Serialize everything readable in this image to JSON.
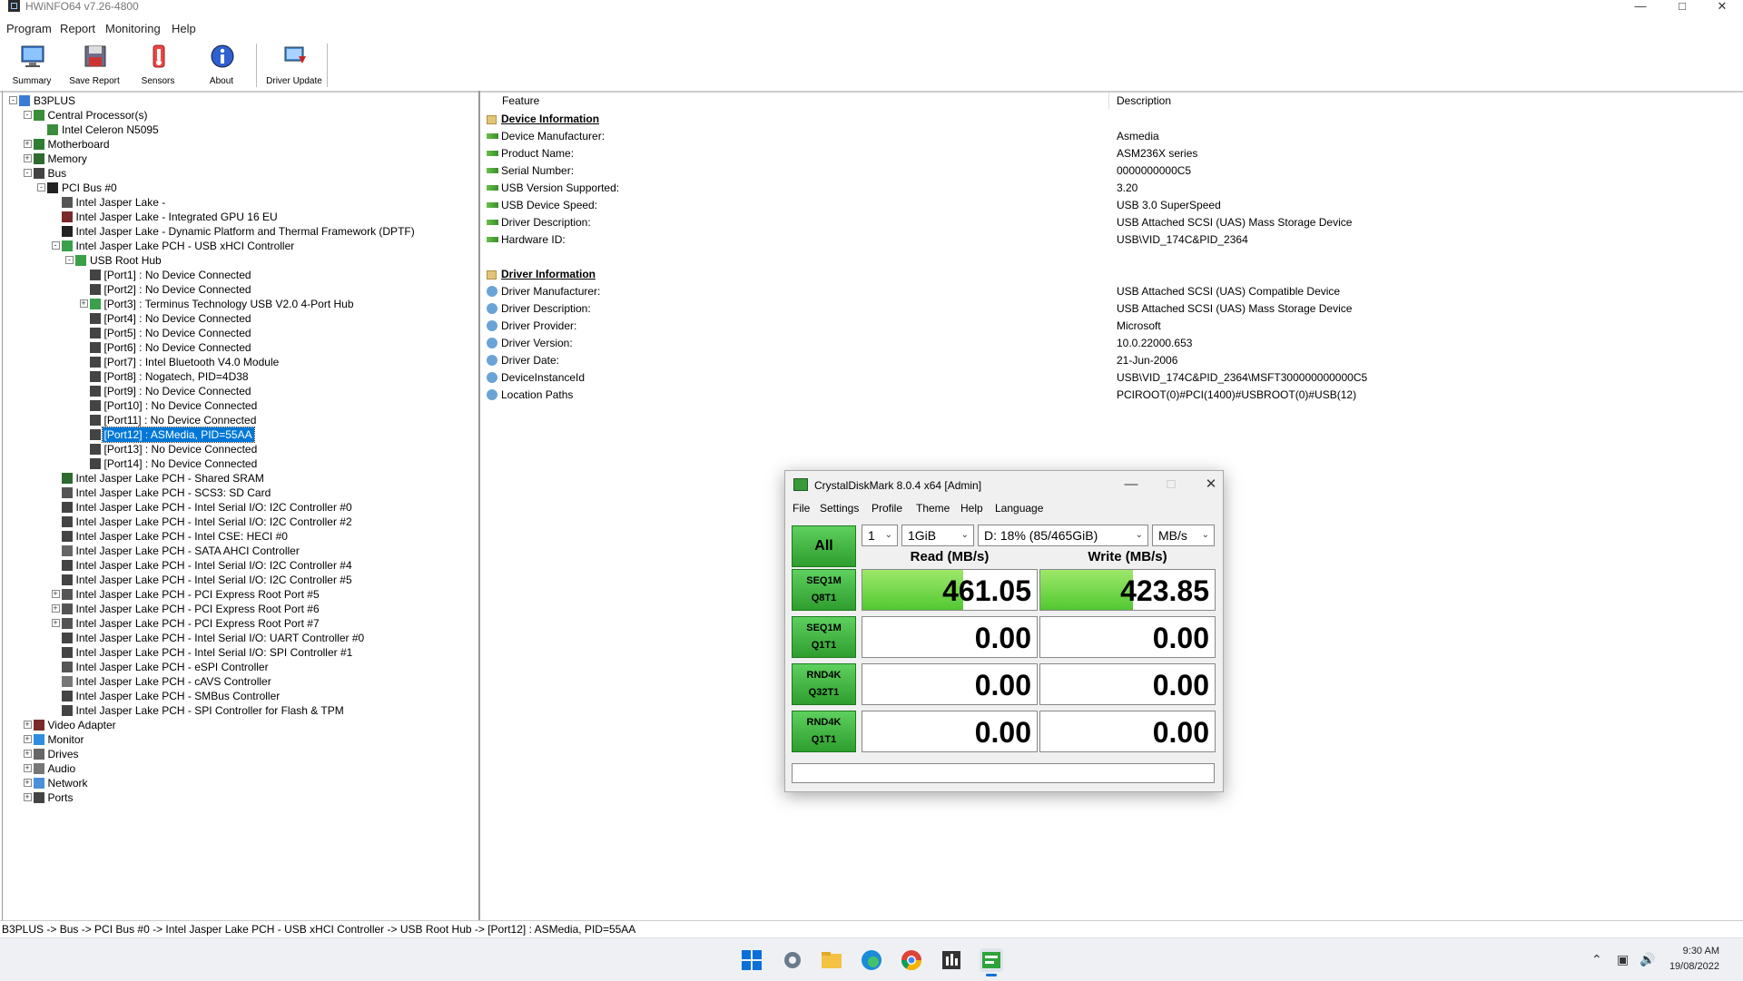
{
  "window": {
    "title": "HWiNFO64 v7.26-4800"
  },
  "menu": [
    "Program",
    "Report",
    "Monitoring",
    "Help"
  ],
  "toolbar": {
    "summary": "Summary",
    "save_report": "Save Report",
    "sensors": "Sensors",
    "about": "About",
    "driver_update": "Driver Update"
  },
  "tree": [
    {
      "label": "B3PLUS",
      "icon": "computer-icon",
      "exp": "-"
    },
    {
      "label": "Central Processor(s)",
      "icon": "cpu-icon",
      "exp": "-"
    },
    {
      "label": "Intel Celeron N5095",
      "icon": "cpu-icon",
      "exp": ""
    },
    {
      "label": "Motherboard",
      "icon": "motherboard-icon",
      "exp": "+"
    },
    {
      "label": "Memory",
      "icon": "memory-icon",
      "exp": "+"
    },
    {
      "label": "Bus",
      "icon": "bus-icon",
      "exp": "-"
    },
    {
      "label": "PCI Bus #0",
      "icon": "pci-icon",
      "exp": "-"
    },
    {
      "label": "Intel Jasper Lake -",
      "icon": "chip-icon",
      "exp": ""
    },
    {
      "label": "Intel Jasper Lake - Integrated GPU 16 EU",
      "icon": "gpu-icon",
      "exp": ""
    },
    {
      "label": "Intel Jasper Lake - Dynamic Platform and Thermal Framework (DPTF)",
      "icon": "pci-icon",
      "exp": ""
    },
    {
      "label": "Intel Jasper Lake PCH - USB xHCI Controller",
      "icon": "usb-icon",
      "exp": "-"
    },
    {
      "label": "USB Root Hub",
      "icon": "usb-icon",
      "exp": "-"
    },
    {
      "label": "[Port1] : No Device Connected",
      "icon": "port-icon",
      "exp": ""
    },
    {
      "label": "[Port2] : No Device Connected",
      "icon": "port-icon",
      "exp": ""
    },
    {
      "label": "[Port3] : Terminus Technology USB V2.0 4-Port Hub",
      "icon": "usb-icon",
      "exp": "+"
    },
    {
      "label": "[Port4] : No Device Connected",
      "icon": "port-icon",
      "exp": ""
    },
    {
      "label": "[Port5] : No Device Connected",
      "icon": "port-icon",
      "exp": ""
    },
    {
      "label": "[Port6] : No Device Connected",
      "icon": "port-icon",
      "exp": ""
    },
    {
      "label": "[Port7] : Intel Bluetooth V4.0 Module",
      "icon": "port-icon",
      "exp": ""
    },
    {
      "label": "[Port8] : Nogatech, PID=4D38",
      "icon": "port-icon",
      "exp": ""
    },
    {
      "label": "[Port9] : No Device Connected",
      "icon": "port-icon",
      "exp": ""
    },
    {
      "label": "[Port10] : No Device Connected",
      "icon": "port-icon",
      "exp": ""
    },
    {
      "label": "[Port11] : No Device Connected",
      "icon": "port-icon",
      "exp": ""
    },
    {
      "label": "[Port12] : ASMedia, PID=55AA",
      "icon": "port-icon",
      "exp": "",
      "selected": true
    },
    {
      "label": "[Port13] : No Device Connected",
      "icon": "port-icon",
      "exp": ""
    },
    {
      "label": "[Port14] : No Device Connected",
      "icon": "port-icon",
      "exp": ""
    },
    {
      "label": "Intel Jasper Lake PCH - Shared SRAM",
      "icon": "memory-icon",
      "exp": ""
    },
    {
      "label": "Intel Jasper Lake PCH - SCS3: SD Card",
      "icon": "chip-icon",
      "exp": ""
    },
    {
      "label": "Intel Jasper Lake PCH - Intel Serial I/O: I2C Controller #0",
      "icon": "bus-icon",
      "exp": ""
    },
    {
      "label": "Intel Jasper Lake PCH - Intel Serial I/O: I2C Controller #2",
      "icon": "bus-icon",
      "exp": ""
    },
    {
      "label": "Intel Jasper Lake PCH - Intel CSE: HECI #0",
      "icon": "bus-icon",
      "exp": ""
    },
    {
      "label": "Intel Jasper Lake PCH - SATA AHCI Controller",
      "icon": "drive-icon",
      "exp": ""
    },
    {
      "label": "Intel Jasper Lake PCH - Intel Serial I/O: I2C Controller #4",
      "icon": "bus-icon",
      "exp": ""
    },
    {
      "label": "Intel Jasper Lake PCH - Intel Serial I/O: I2C Controller #5",
      "icon": "bus-icon",
      "exp": ""
    },
    {
      "label": "Intel Jasper Lake PCH - PCI Express Root Port #5",
      "icon": "chip-icon",
      "exp": "+"
    },
    {
      "label": "Intel Jasper Lake PCH - PCI Express Root Port #6",
      "icon": "chip-icon",
      "exp": "+"
    },
    {
      "label": "Intel Jasper Lake PCH - PCI Express Root Port #7",
      "icon": "chip-icon",
      "exp": "+"
    },
    {
      "label": "Intel Jasper Lake PCH - Intel Serial I/O: UART Controller #0",
      "icon": "port-icon",
      "exp": ""
    },
    {
      "label": "Intel Jasper Lake PCH - Intel Serial I/O: SPI Controller #1",
      "icon": "bus-icon",
      "exp": ""
    },
    {
      "label": "Intel Jasper Lake PCH - eSPI Controller",
      "icon": "chip-icon",
      "exp": ""
    },
    {
      "label": "Intel Jasper Lake PCH - cAVS Controller",
      "icon": "audio-icon",
      "exp": ""
    },
    {
      "label": "Intel Jasper Lake PCH - SMBus Controller",
      "icon": "bus-icon",
      "exp": ""
    },
    {
      "label": "Intel Jasper Lake PCH - SPI Controller for Flash & TPM",
      "icon": "bus-icon",
      "exp": ""
    },
    {
      "label": "Video Adapter",
      "icon": "gpu-icon",
      "exp": "+"
    },
    {
      "label": "Monitor",
      "icon": "monitor-icon",
      "exp": "+"
    },
    {
      "label": "Drives",
      "icon": "drive-icon",
      "exp": "+"
    },
    {
      "label": "Audio",
      "icon": "audio-icon",
      "exp": "+"
    },
    {
      "label": "Network",
      "icon": "network-icon",
      "exp": "+"
    },
    {
      "label": "Ports",
      "icon": "port-icon",
      "exp": "+"
    }
  ],
  "detail": {
    "col_feature": "Feature",
    "col_description": "Description",
    "rows": [
      {
        "section": true,
        "feature": "Device Information",
        "desc": ""
      },
      {
        "feature": "Device Manufacturer:",
        "desc": "Asmedia",
        "icon": "usb"
      },
      {
        "feature": "Product Name:",
        "desc": "ASM236X series",
        "icon": "usb"
      },
      {
        "feature": "Serial Number:",
        "desc": "0000000000C5",
        "icon": "usb"
      },
      {
        "feature": "USB Version Supported:",
        "desc": "3.20",
        "icon": "usb"
      },
      {
        "feature": "USB Device Speed:",
        "desc": "USB 3.0 SuperSpeed",
        "icon": "usb"
      },
      {
        "feature": "Driver Description:",
        "desc": "USB Attached SCSI (UAS) Mass Storage Device",
        "icon": "usb"
      },
      {
        "feature": "Hardware ID:",
        "desc": "USB\\VID_174C&PID_2364",
        "icon": "usb"
      },
      {
        "blank": true
      },
      {
        "section": true,
        "feature": "Driver Information",
        "desc": ""
      },
      {
        "feature": "Driver Manufacturer:",
        "desc": "USB Attached SCSI (UAS) Compatible Device",
        "icon": "gear"
      },
      {
        "feature": "Driver Description:",
        "desc": "USB Attached SCSI (UAS) Mass Storage Device",
        "icon": "gear"
      },
      {
        "feature": "Driver Provider:",
        "desc": "Microsoft",
        "icon": "gear"
      },
      {
        "feature": "Driver Version:",
        "desc": "10.0.22000.653",
        "icon": "gear"
      },
      {
        "feature": "Driver Date:",
        "desc": "21-Jun-2006",
        "icon": "gear"
      },
      {
        "feature": "DeviceInstanceId",
        "desc": "USB\\VID_174C&PID_2364\\MSFT300000000000C5",
        "icon": "gear"
      },
      {
        "feature": "Location Paths",
        "desc": "PCIROOT(0)#PCI(1400)#USBROOT(0)#USB(12)",
        "icon": "gear"
      }
    ]
  },
  "status": "B3PLUS -> Bus -> PCI Bus #0 -> Intel Jasper Lake PCH - USB xHCI Controller -> USB Root Hub -> [Port12] : ASMedia, PID=55AA",
  "cdm": {
    "title": "CrystalDiskMark 8.0.4 x64 [Admin]",
    "menu": [
      "File",
      "Settings",
      "Profile",
      "Theme",
      "Help",
      "Language"
    ],
    "all_label": "All",
    "count": "1",
    "size": "1GiB",
    "drive": "D: 18% (85/465GiB)",
    "unit": "MB/s",
    "read_header": "Read (MB/s)",
    "write_header": "Write (MB/s)",
    "max_mbps": 800,
    "tests": [
      {
        "l1": "SEQ1M",
        "l2": "Q8T1",
        "read": "461.05",
        "write": "423.85",
        "read_val": 461.05,
        "write_val": 423.85
      },
      {
        "l1": "SEQ1M",
        "l2": "Q1T1",
        "read": "0.00",
        "write": "0.00",
        "read_val": 0,
        "write_val": 0
      },
      {
        "l1": "RND4K",
        "l2": "Q32T1",
        "read": "0.00",
        "write": "0.00",
        "read_val": 0,
        "write_val": 0
      },
      {
        "l1": "RND4K",
        "l2": "Q1T1",
        "read": "0.00",
        "write": "0.00",
        "read_val": 0,
        "write_val": 0
      }
    ]
  },
  "taskbar": {
    "time": "9:30 AM",
    "date": "19/08/2022"
  }
}
